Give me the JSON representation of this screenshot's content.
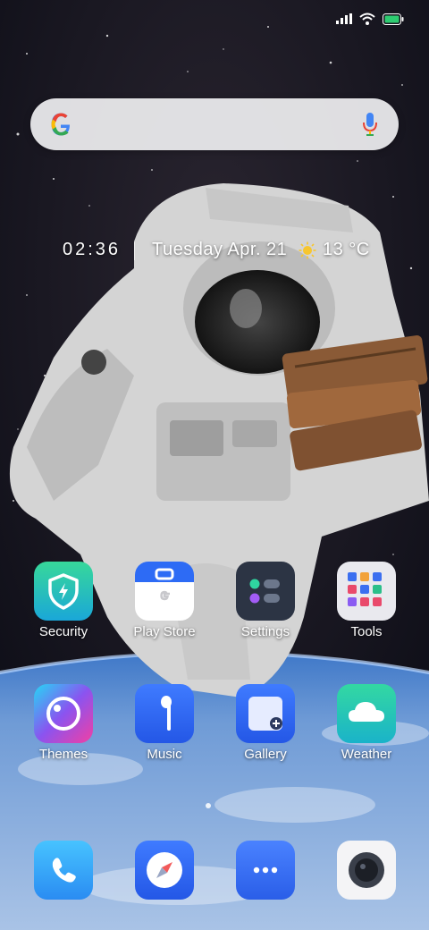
{
  "status_bar": {
    "icons": [
      "signal-icon",
      "wifi-icon",
      "battery-icon"
    ],
    "battery_color": "#2ecc71"
  },
  "search": {
    "icon": "google-g-icon",
    "voice_icon": "mic-icon"
  },
  "clock": {
    "time": "02:36",
    "date": "Tuesday Apr. 21",
    "weather_icon": "sun-icon",
    "temperature": "13 °C"
  },
  "apps": {
    "security": {
      "label": "Security",
      "icon": "shield-bolt-icon"
    },
    "play_store": {
      "label": "Play Store",
      "icon": "briefcase-icon"
    },
    "settings": {
      "label": "Settings",
      "icon": "settings-icon"
    },
    "tools": {
      "label": "Tools",
      "icon": "tools-grid-icon"
    },
    "themes": {
      "label": "Themes",
      "icon": "themes-icon"
    },
    "music": {
      "label": "Music",
      "icon": "earphone-icon"
    },
    "gallery": {
      "label": "Gallery",
      "icon": "gallery-icon"
    },
    "weather": {
      "label": "Weather",
      "icon": "cloud-icon"
    }
  },
  "dock": {
    "phone": {
      "icon": "phone-icon"
    },
    "browser": {
      "icon": "compass-icon"
    },
    "messages": {
      "icon": "chat-dots-icon"
    },
    "camera": {
      "icon": "camera-icon"
    }
  }
}
